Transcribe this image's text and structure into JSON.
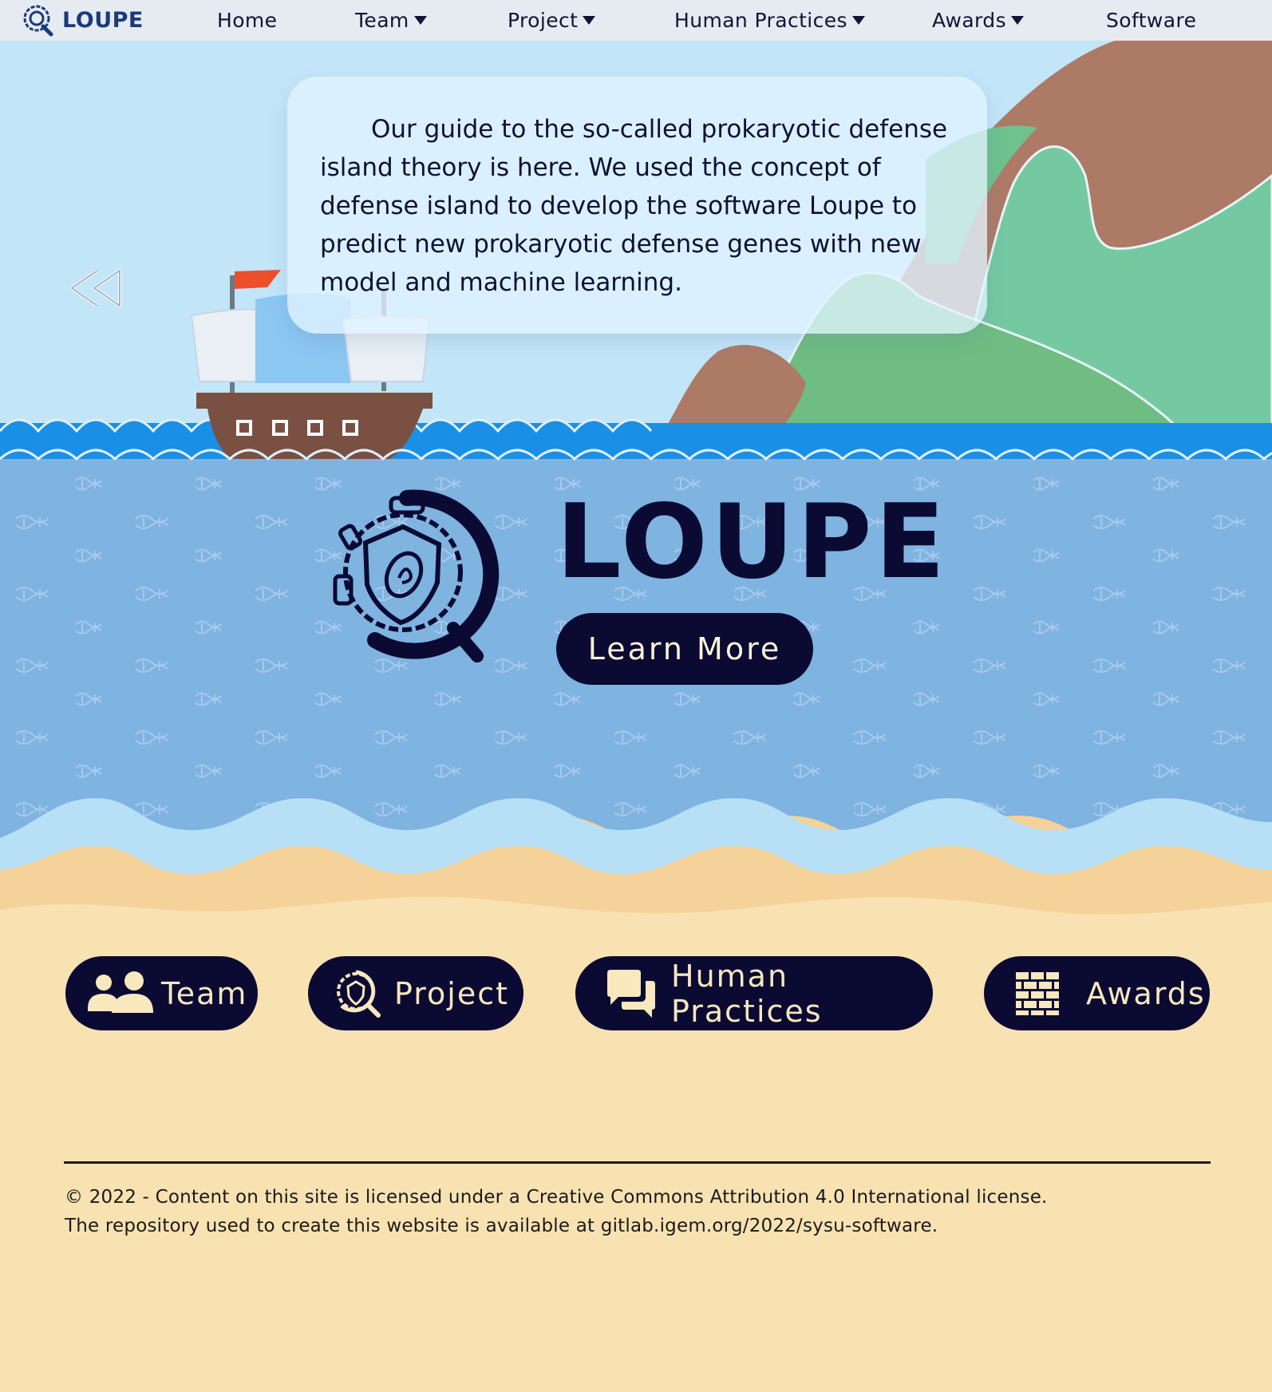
{
  "nav": {
    "brand": "LOUPE",
    "items": [
      {
        "label": "Home",
        "dropdown": false
      },
      {
        "label": "Team",
        "dropdown": true
      },
      {
        "label": "Project",
        "dropdown": true
      },
      {
        "label": "Human Practices",
        "dropdown": true
      },
      {
        "label": "Awards",
        "dropdown": true
      },
      {
        "label": "Software",
        "dropdown": false
      }
    ]
  },
  "hero": {
    "intro": "Our guide to the so-called prokaryotic defense island theory is here. We used the concept of defense island to develop the software Loupe to predict new prokaryotic defense genes with new model and machine learning.",
    "title": "LOUPE",
    "cta": "Learn More",
    "back_icon": "double-chevron-left-icon"
  },
  "sections": [
    {
      "label": "Team",
      "icon": "users-icon"
    },
    {
      "label": "Project",
      "icon": "loupe-logo-icon"
    },
    {
      "label": "Human Practices",
      "icon": "chat-bubbles-icon"
    },
    {
      "label": "Awards",
      "icon": "bricks-icon"
    }
  ],
  "footer": {
    "line1": "© 2022 - Content on this site is licensed under a Creative Commons Attribution 4.0 International license.",
    "line2": "The repository used to create this website is available at gitlab.igem.org/2022/sysu-software."
  },
  "colors": {
    "nav_bg": "#e6ebf1",
    "sky": "#c3e5f8",
    "sea": "#7fb3e0",
    "sand": "#f8e2b2",
    "dark": "#0a0a33"
  }
}
